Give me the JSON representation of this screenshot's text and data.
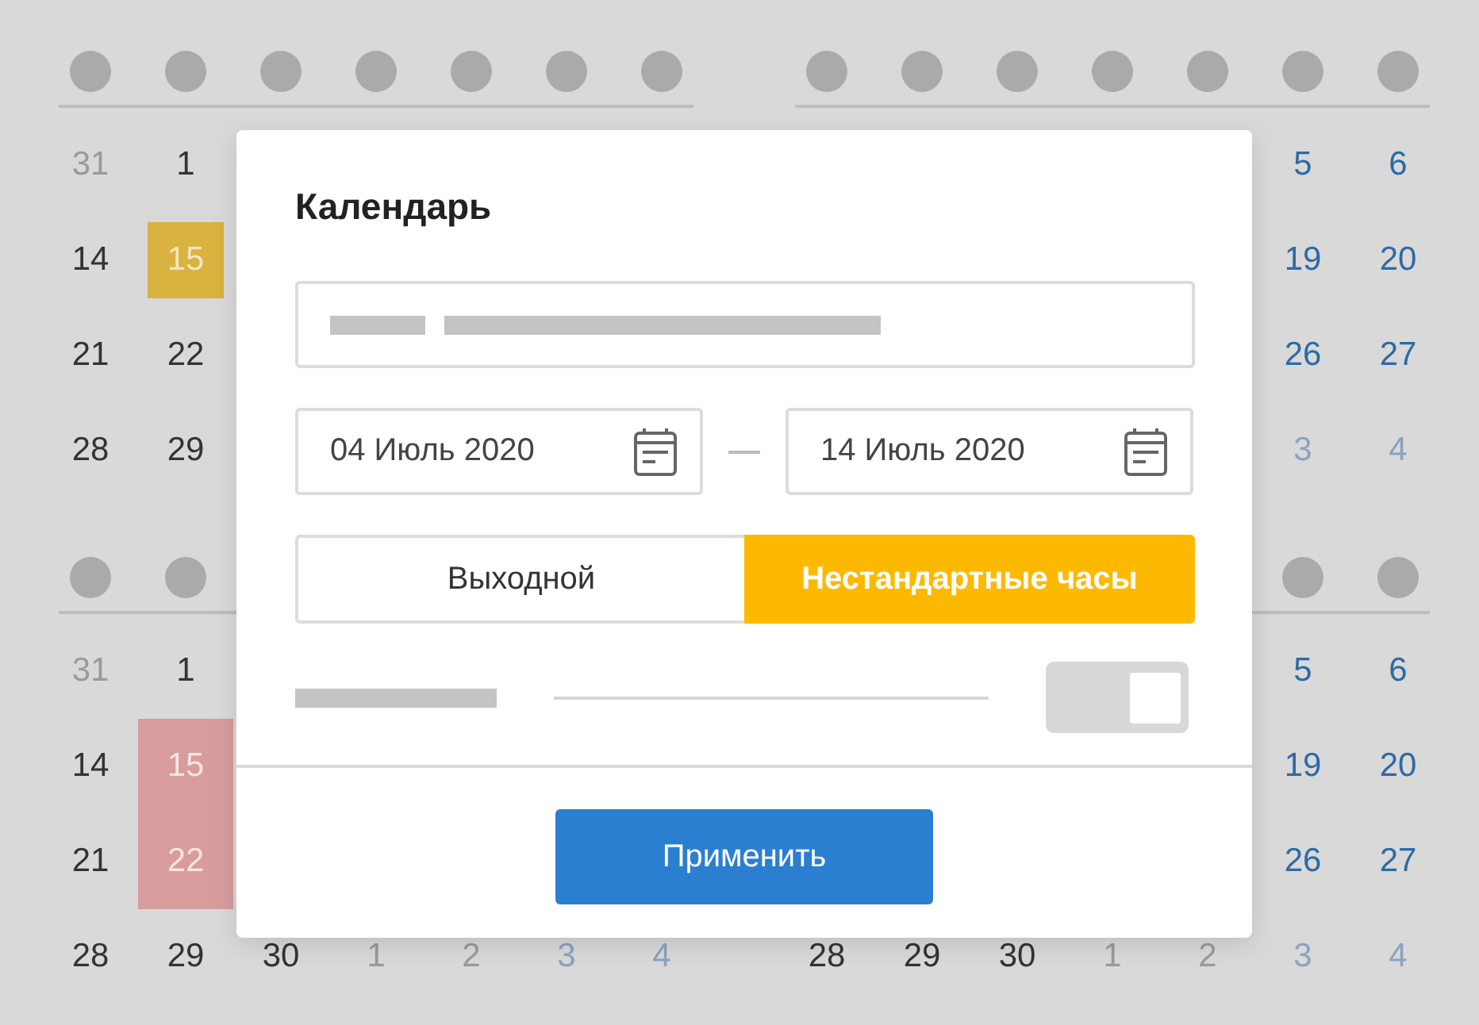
{
  "calendars": [
    {
      "header": {
        "dots": [
          {
            "kind": "dot"
          },
          {
            "kind": "dot"
          },
          {
            "kind": "dot"
          },
          {
            "kind": "dot"
          },
          {
            "kind": "dot"
          },
          {
            "kind": "dot"
          },
          {
            "kind": "dot"
          }
        ]
      },
      "weeks": [
        {
          "days": [
            {
              "text": "31",
              "kind": "muted"
            },
            {
              "text": "1",
              "kind": "day"
            }
          ]
        },
        {
          "days": [
            {
              "text": "14",
              "kind": "day"
            },
            {
              "text": "15",
              "kind": "selected",
              "color": "#d9b240"
            }
          ]
        },
        {
          "days": [
            {
              "text": "21",
              "kind": "day"
            },
            {
              "text": "22",
              "kind": "day"
            }
          ]
        },
        {
          "days": [
            {
              "text": "28",
              "kind": "day"
            },
            {
              "text": "29",
              "kind": "day"
            }
          ]
        }
      ]
    },
    {
      "header": {
        "dots": [
          {
            "kind": "dot"
          },
          {
            "kind": "dot"
          },
          {
            "kind": "dot"
          },
          {
            "kind": "dot"
          },
          {
            "kind": "dot"
          },
          {
            "kind": "dot"
          },
          {
            "kind": "dot"
          }
        ]
      },
      "weeks": [
        {
          "trailing": true,
          "days": [
            {
              "text": "5",
              "kind": "weekend"
            },
            {
              "text": "6",
              "kind": "weekend"
            }
          ]
        },
        {
          "trailing": true,
          "days": [
            {
              "text": "19",
              "kind": "weekend"
            },
            {
              "text": "20",
              "kind": "weekend"
            }
          ]
        },
        {
          "trailing": true,
          "days": [
            {
              "text": "26",
              "kind": "weekend"
            },
            {
              "text": "27",
              "kind": "weekend"
            }
          ]
        },
        {
          "trailing": true,
          "days": [
            {
              "text": "3",
              "kind": "weekend-muted"
            },
            {
              "text": "4",
              "kind": "weekend-muted"
            }
          ]
        }
      ]
    },
    {
      "header": {
        "dots": [
          {
            "kind": "dot"
          },
          {
            "kind": "dot"
          }
        ]
      },
      "weeks": [
        {
          "days": [
            {
              "text": "31",
              "kind": "muted"
            },
            {
              "text": "1",
              "kind": "day"
            }
          ]
        },
        {
          "days": [
            {
              "text": "14",
              "kind": "day"
            },
            {
              "text": "15",
              "kind": "range",
              "color": "#d89c9c"
            }
          ]
        },
        {
          "days": [
            {
              "text": "21",
              "kind": "day"
            },
            {
              "text": "22",
              "kind": "range",
              "color": "#d89c9c"
            }
          ]
        },
        {
          "days": [
            {
              "text": "28",
              "kind": "day"
            },
            {
              "text": "29",
              "kind": "day"
            },
            {
              "text": "30",
              "kind": "day"
            },
            {
              "text": "1",
              "kind": "muted"
            },
            {
              "text": "2",
              "kind": "muted"
            },
            {
              "text": "3",
              "kind": "weekend-muted"
            },
            {
              "text": "4",
              "kind": "weekend-muted"
            }
          ]
        }
      ]
    },
    {
      "header": {
        "trailing": true,
        "dots": [
          {
            "kind": "dot"
          },
          {
            "kind": "dot"
          }
        ]
      },
      "weeks": [
        {
          "trailing": true,
          "days": [
            {
              "text": "5",
              "kind": "weekend"
            },
            {
              "text": "6",
              "kind": "weekend"
            }
          ]
        },
        {
          "trailing": true,
          "days": [
            {
              "text": "19",
              "kind": "weekend"
            },
            {
              "text": "20",
              "kind": "weekend"
            }
          ]
        },
        {
          "trailing": true,
          "days": [
            {
              "text": "26",
              "kind": "weekend"
            },
            {
              "text": "27",
              "kind": "weekend"
            }
          ]
        },
        {
          "days": [
            {
              "text": "28",
              "kind": "day"
            },
            {
              "text": "29",
              "kind": "day"
            },
            {
              "text": "30",
              "kind": "day"
            },
            {
              "text": "1",
              "kind": "muted"
            },
            {
              "text": "2",
              "kind": "muted"
            },
            {
              "text": "3",
              "kind": "weekend-muted"
            },
            {
              "text": "4",
              "kind": "weekend-muted"
            }
          ]
        }
      ]
    }
  ],
  "dialog": {
    "title": "Календарь",
    "name_field": {
      "kind": "skeleton"
    },
    "date_from": "04 Июль 2020",
    "date_to": "14 Июль 2020",
    "modes": [
      {
        "label": "Выходной",
        "selected": false
      },
      {
        "label": "Нестандартные часы",
        "selected": true
      }
    ],
    "option_row": {
      "on": true
    },
    "apply_button": "Применить"
  }
}
